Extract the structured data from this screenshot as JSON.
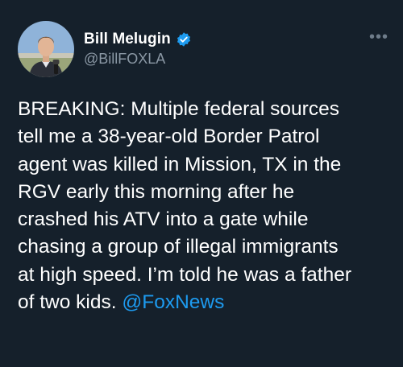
{
  "author": {
    "display_name": "Bill Melugin",
    "handle": "@BillFOXLA",
    "verified": true
  },
  "tweet": {
    "text": "BREAKING: Multiple federal sources\ntell me a 38-year-old Border Patrol\nagent was killed in Mission, TX in the\nRGV early this morning after he\ncrashed his ATV into a gate while\nchasing a group of illegal immigrants\nat high speed. I’m told he was a father\nof two kids. ",
    "mention": "@FoxNews"
  },
  "icons": {
    "more": "more-options-icon",
    "verified": "verified-badge-icon"
  },
  "colors": {
    "background": "#15202b",
    "text": "#ffffff",
    "secondary": "#8b98a5",
    "accent": "#1d9bf0"
  }
}
